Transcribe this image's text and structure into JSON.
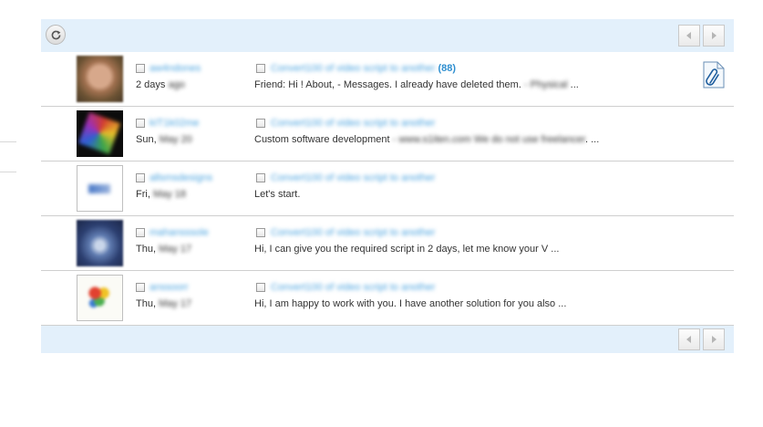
{
  "toolbar": {
    "refresh_icon": "refresh-icon",
    "prev_icon": "arrow-left-icon",
    "next_icon": "arrow-right-icon"
  },
  "messages": [
    {
      "sender": "aw4ndones",
      "date_prefix": "2 days",
      "date_rest": " ago",
      "subject": "Convert100 of video script to another",
      "count": "(88)",
      "msg_a": "Friend: Hi ! About, - Messages. I already have deleted them. ",
      "msg_blur": "- Physical",
      "msg_b": " ...",
      "has_attachment": true
    },
    {
      "sender": "kIT1k02me",
      "date_prefix": "Sun,",
      "date_rest": " May 20",
      "subject": "Convert100 of video script to another",
      "count": "",
      "msg_a": "Custom software development ",
      "msg_blur": "- www.s1iten.com We do not use freelancer",
      "msg_b": ". ...",
      "has_attachment": false
    },
    {
      "sender": "allsmsdesigns",
      "date_prefix": "Fri,",
      "date_rest": " May 18",
      "subject": "Convert100 of video script to another",
      "count": "",
      "msg_a": "Let's start.",
      "msg_blur": "",
      "msg_b": "",
      "has_attachment": false
    },
    {
      "sender": "mahansssole",
      "date_prefix": "Thu,",
      "date_rest": " May 17",
      "subject": "Convert100 of video script to another",
      "count": "",
      "msg_a": "Hi, I can give you the required script in 2 days, let me know your V ...",
      "msg_blur": "",
      "msg_b": "",
      "has_attachment": false
    },
    {
      "sender": "anssoorr",
      "date_prefix": "Thu,",
      "date_rest": " May 17",
      "subject": "Convert100 of video script to another",
      "count": "",
      "msg_a": "Hi, I am happy to work with you. I have another solution for you also ...",
      "msg_blur": "",
      "msg_b": "",
      "has_attachment": false
    }
  ]
}
